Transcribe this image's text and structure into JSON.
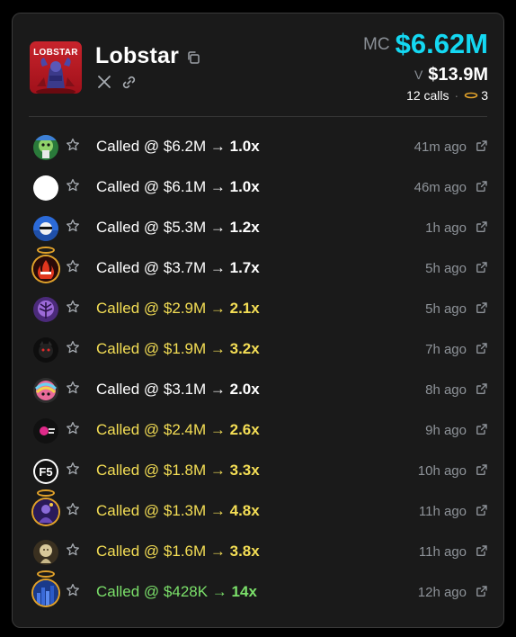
{
  "token": {
    "name": "Lobstar",
    "logo_text": "LOBSTAR",
    "mc_label": "MC",
    "mc_value": "$6.62M",
    "vol_label": "V",
    "vol_value": "$13.9M",
    "calls_text": "12 calls",
    "halo_count": "3"
  },
  "colors": {
    "accent_cyan": "#14d8f2",
    "call_white": "#ffffff",
    "call_yellow": "#f4de55",
    "call_green": "#7be06a",
    "halo_gold": "#e0a12a"
  },
  "calls": [
    {
      "prefix": "Called @ ",
      "mc": "$6.2M",
      "arrow": " → ",
      "mult": "1.0x",
      "time": "41m ago",
      "tier": "white",
      "halo": false,
      "avatar": "green-character"
    },
    {
      "prefix": "Called @ ",
      "mc": "$6.1M",
      "arrow": " → ",
      "mult": "1.0x",
      "time": "46m ago",
      "tier": "white",
      "halo": false,
      "avatar": "white-circle"
    },
    {
      "prefix": "Called @ ",
      "mc": "$5.3M",
      "arrow": " → ",
      "mult": "1.2x",
      "time": "1h ago",
      "tier": "white",
      "halo": false,
      "avatar": "blue-sunglasses"
    },
    {
      "prefix": "Called @ ",
      "mc": "$3.7M",
      "arrow": " → ",
      "mult": "1.7x",
      "time": "5h ago",
      "tier": "white",
      "halo": true,
      "avatar": "red-fire"
    },
    {
      "prefix": "Called @ ",
      "mc": "$2.9M",
      "arrow": " → ",
      "mult": "2.1x",
      "time": "5h ago",
      "tier": "yellow",
      "halo": false,
      "avatar": "purple-tree"
    },
    {
      "prefix": "Called @ ",
      "mc": "$1.9M",
      "arrow": " → ",
      "mult": "3.2x",
      "time": "7h ago",
      "tier": "yellow",
      "halo": false,
      "avatar": "black-cat"
    },
    {
      "prefix": "Called @ ",
      "mc": "$3.1M",
      "arrow": " → ",
      "mult": "2.0x",
      "time": "8h ago",
      "tier": "white",
      "halo": false,
      "avatar": "rainbow-face"
    },
    {
      "prefix": "Called @ ",
      "mc": "$2.4M",
      "arrow": " → ",
      "mult": "2.6x",
      "time": "9h ago",
      "tier": "yellow",
      "halo": false,
      "avatar": "pink-logo"
    },
    {
      "prefix": "Called @ ",
      "mc": "$1.8M",
      "arrow": " → ",
      "mult": "3.3x",
      "time": "10h ago",
      "tier": "yellow",
      "halo": false,
      "avatar": "f5-logo"
    },
    {
      "prefix": "Called @ ",
      "mc": "$1.3M",
      "arrow": " → ",
      "mult": "4.8x",
      "time": "11h ago",
      "tier": "yellow",
      "halo": true,
      "avatar": "purple-figure"
    },
    {
      "prefix": "Called @ ",
      "mc": "$1.6M",
      "arrow": " → ",
      "mult": "3.8x",
      "time": "11h ago",
      "tier": "yellow",
      "halo": false,
      "avatar": "statue-face"
    },
    {
      "prefix": "Called @ ",
      "mc": "$428K",
      "arrow": " → ",
      "mult": "14x",
      "time": "12h ago",
      "tier": "green",
      "halo": true,
      "avatar": "blue-city"
    }
  ]
}
